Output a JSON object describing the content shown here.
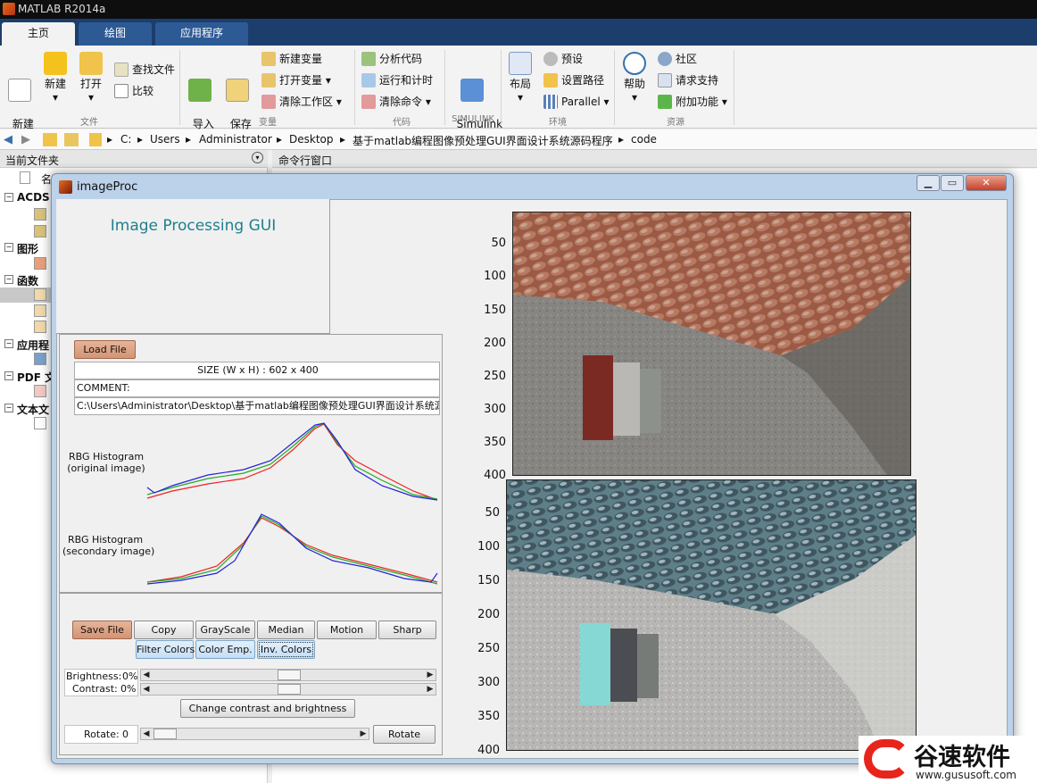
{
  "app": {
    "title": "MATLAB R2014a"
  },
  "ribbon": {
    "tabs": [
      {
        "label": "主页"
      },
      {
        "label": "绘图"
      },
      {
        "label": "应用程序"
      }
    ],
    "file_group": {
      "label": "文件",
      "new_script": "新建\n脚本",
      "new": "新建",
      "open": "打开",
      "find_files": "查找文件",
      "compare": "比较"
    },
    "variable_group": {
      "label": "变量",
      "import": "导入\n数据",
      "save_ws": "保存\n工作区",
      "new_var": "新建变量",
      "open_var": "打开变量",
      "clear_ws": "清除工作区"
    },
    "code_group": {
      "label": "代码",
      "analyze": "分析代码",
      "run_time": "运行和计时",
      "clear_cmd": "清除命令"
    },
    "simulink_group": {
      "label": "SIMULINK",
      "simulink": "Simulink\n库"
    },
    "env_group": {
      "label": "环境",
      "layout": "布局",
      "prefs": "预设",
      "set_path": "设置路径",
      "parallel": "Parallel"
    },
    "resources_group": {
      "label": "资源",
      "help": "帮助",
      "community": "社区",
      "request_support": "请求支持",
      "addons": "附加功能"
    }
  },
  "address": {
    "crumbs": [
      "C:",
      "Users",
      "Administrator",
      "Desktop",
      "基于matlab编程图像预处理GUI界面设计系统源码程序",
      "code"
    ]
  },
  "left_panel": {
    "title": "当前文件夹",
    "col_name": "名",
    "items": [
      "ACDS",
      "图形",
      "函数",
      "应用程",
      "PDF 文",
      "文本文"
    ]
  },
  "command_window": {
    "title": "命令行窗口"
  },
  "figure": {
    "title": "imageProc",
    "heading": "Image Processing GUI",
    "load_button": "Load File",
    "size_text": "SIZE (W x H) : 602 x 400",
    "comment_text": "COMMENT:",
    "path_text": "C:\\Users\\Administrator\\Desktop\\基于matlab编程图像预处理GUI界面设计系统源码程序",
    "hist1_label": "RBG Histogram\n(original image)",
    "hist2_label": "RBG Histogram\n(secondary image)",
    "buttons": {
      "save": "Save File",
      "copy": "Copy",
      "grayscale": "GrayScale",
      "median": "Median",
      "motion": "Motion",
      "sharp": "Sharp",
      "filter": "Filter Colors",
      "color_emp": "Color Emp.",
      "inv": "Inv. Colors",
      "change": "Change contrast and brightness",
      "rotate": "Rotate"
    },
    "brightness_label": "Brightness:",
    "brightness_value": "0%",
    "contrast_label": "Contrast:",
    "contrast_value": "0%",
    "rotate_label": "Rotate:",
    "rotate_value": "0",
    "yticks_top": [
      "50",
      "100",
      "150",
      "200",
      "250",
      "300",
      "350",
      "400"
    ],
    "yticks_bottom": [
      "50",
      "100",
      "150",
      "200",
      "250",
      "300",
      "350",
      "400"
    ]
  },
  "watermark": {
    "brand": "谷速软件",
    "url": "www.gususoft.com"
  },
  "colors": {
    "ribbon_tab_bg": "#1c3e6c",
    "heading": "#1e7f8c",
    "orange_button": "#d49473",
    "blue_button": "#c4def5"
  }
}
